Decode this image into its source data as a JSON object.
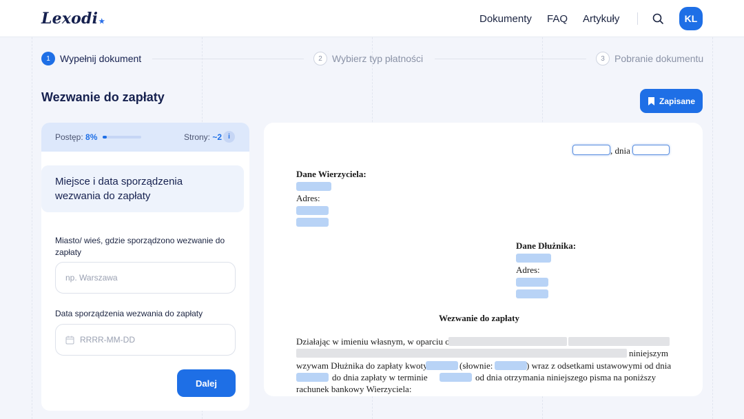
{
  "header": {
    "logo": "Lexodi",
    "nav": [
      "Dokumenty",
      "FAQ",
      "Artykuły"
    ],
    "avatar_initials": "KL"
  },
  "steps": [
    {
      "number": "1",
      "label": "Wypełnij dokument",
      "active": true
    },
    {
      "number": "2",
      "label": "Wybierz typ płatności",
      "active": false
    },
    {
      "number": "3",
      "label": "Pobranie dokumentu",
      "active": false
    }
  ],
  "page_title": "Wezwanie do zapłaty",
  "saved_label": "Zapisane",
  "progress": {
    "label": "Postęp:",
    "value": "8%",
    "fraction": 0.08,
    "pages_label": "Strony:",
    "pages_value": "~2"
  },
  "form": {
    "section_title": "Miejsce i data sporządzenia wezwania do zapłaty",
    "city_label": "Miasto/ wieś, gdzie sporządzono wezwanie do zapłaty",
    "city_placeholder": "np. Warszawa",
    "date_label": "Data sporządzenia wezwania do zapłaty",
    "date_placeholder": "RRRR-MM-DD",
    "next_label": "Dalej"
  },
  "document": {
    "date_sep": ", dnia",
    "creditor_heading": "Dane Wierzyciela:",
    "address_label": "Adres:",
    "debtor_heading": "Dane Dłużnika:",
    "title": "Wezwanie do zapłaty",
    "p1_start": "Działając w imieniu własnym, w oparciu o",
    "p1_end": "niniejszym",
    "p2_start": "wzywam Dłużnika do zapłaty kwoty",
    "p2_words": "(słownie:",
    "p2_end": ") wraz z odsetkami ustawowymi od dnia",
    "p3_mid": "do dnia zapłaty w terminie",
    "p3_end": "od dnia otrzymania niniejszego pisma na poniższy",
    "p4": "rachunek bankowy Wierzyciela:"
  },
  "colors": {
    "accent": "#1e6fe6",
    "placeholder": "#b8d3f6",
    "background": "#f3f5fb"
  }
}
